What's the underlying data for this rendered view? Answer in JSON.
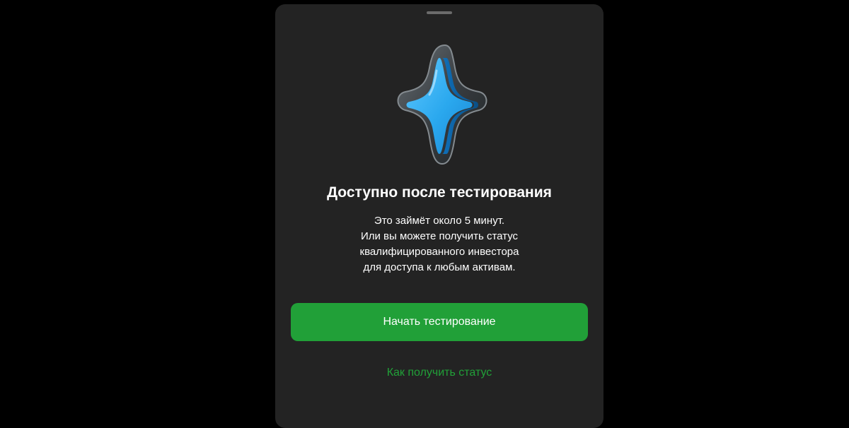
{
  "sheet": {
    "hero_icon": "blue-star-icon",
    "title": "Доступно после тестирования",
    "description_lines": [
      "Это займёт около 5 минут.",
      "Или вы можете получить статус",
      "квалифицированного инвестора",
      "для доступа к любым активам."
    ],
    "primary_button": "Начать тестирование",
    "secondary_link": "Как получить статус"
  },
  "colors": {
    "background": "#000000",
    "sheet": "#232323",
    "accent_green": "#21a038",
    "star_blue": "#2aa8ee",
    "text": "#ffffff"
  }
}
